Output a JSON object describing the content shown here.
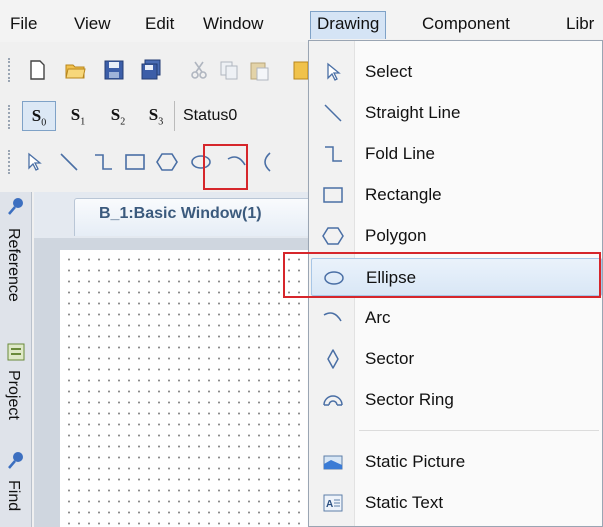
{
  "menubar": {
    "items": [
      "File",
      "View",
      "Edit",
      "Window",
      "Drawing",
      "Component",
      "Libr"
    ],
    "active": "Drawing"
  },
  "toolbar_standard": {
    "icons": [
      "new-icon",
      "open-folder-icon",
      "save-icon",
      "save-all-icon",
      "cut-icon",
      "copy-icon",
      "paste-icon"
    ]
  },
  "toolbar_state": {
    "buttons": [
      {
        "letter": "S",
        "sub": "0"
      },
      {
        "letter": "S",
        "sub": "1"
      },
      {
        "letter": "S",
        "sub": "2"
      },
      {
        "letter": "S",
        "sub": "3"
      }
    ],
    "selected_state": "Status0"
  },
  "toolbar_drawing": {
    "tools": [
      "select-arrow-icon",
      "straight-line-icon",
      "fold-line-icon",
      "rectangle-icon",
      "polygon-icon",
      "ellipse-icon",
      "arc-icon",
      "sector-icon"
    ]
  },
  "dock": {
    "tabs": [
      "Reference",
      "Project",
      "Find"
    ]
  },
  "document": {
    "tab_title": "B_1:Basic Window(1)"
  },
  "drawing_menu": {
    "items": [
      {
        "label": "Select",
        "icon": "select-arrow-icon"
      },
      {
        "label": "Straight Line",
        "icon": "straight-line-icon"
      },
      {
        "label": "Fold Line",
        "icon": "fold-line-icon"
      },
      {
        "label": "Rectangle",
        "icon": "rectangle-icon"
      },
      {
        "label": "Polygon",
        "icon": "polygon-icon"
      },
      {
        "label": "Ellipse",
        "icon": "ellipse-icon"
      },
      {
        "label": "Arc",
        "icon": "arc-icon"
      },
      {
        "label": "Sector",
        "icon": "sector-icon"
      },
      {
        "label": "Sector Ring",
        "icon": "sector-ring-icon"
      },
      {
        "label": "Static Picture",
        "icon": "static-picture-icon"
      },
      {
        "label": "Static Text",
        "icon": "static-text-icon"
      }
    ],
    "highlighted": "Ellipse"
  },
  "colors": {
    "highlight_red": "#d6262b",
    "menu_hover": "#d9e7f6",
    "tab_text": "#3b5a7d"
  }
}
